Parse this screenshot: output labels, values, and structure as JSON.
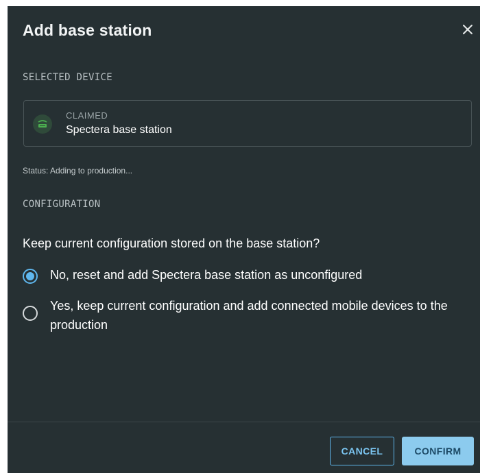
{
  "dialog": {
    "title": "Add base station",
    "close_icon": "close-icon"
  },
  "selected_device": {
    "section_label": "SELECTED DEVICE",
    "state": "CLAIMED",
    "name": "Spectera base station",
    "icon": "base-station-icon",
    "icon_color": "#4caf50"
  },
  "status": "Status: Adding to production...",
  "configuration": {
    "section_label": "CONFIGURATION",
    "question": "Keep current configuration stored on the base station?",
    "options": [
      {
        "label": "No, reset and add Spectera base station as unconfigured",
        "selected": true
      },
      {
        "label": "Yes, keep current configuration and add connected mobile devices to the production",
        "selected": false
      }
    ]
  },
  "footer": {
    "cancel_label": "CANCEL",
    "confirm_label": "CONFIRM"
  },
  "colors": {
    "background": "#263033",
    "accent": "#5fb7ee"
  }
}
